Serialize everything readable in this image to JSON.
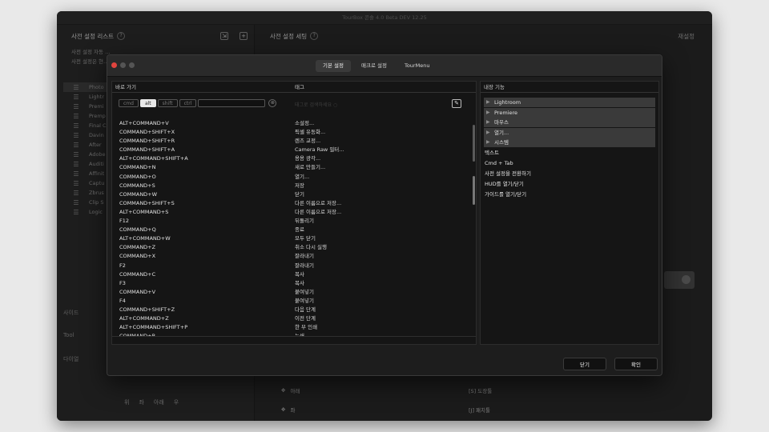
{
  "app": {
    "window_title": "TourBox 콘솔 4.0 Beta DEV 12.25",
    "left_header": "사전 설정 리스트",
    "left_sub": [
      "사전 설정 자동 …",
      "사전 설정은 현…"
    ],
    "presets": [
      "Photo",
      "Lightr",
      "Premi",
      "Premp",
      "Final C",
      "Davin",
      "After",
      "Adobe",
      "Auditi",
      "Affinit",
      "Captu",
      "Zbrus",
      "Clip S",
      "Logic"
    ],
    "left_bottom": [
      "사이드",
      "Tool",
      "다이얼"
    ],
    "directions": [
      "위",
      "좌",
      "아래",
      "우"
    ],
    "right_header": "사전 설정 세팅",
    "reset_label": "재설정",
    "bottom_actions": [
      "아래",
      "좌"
    ],
    "bottom_keys": [
      "[S] 도장툴",
      "[J] 패치툴"
    ]
  },
  "dialog": {
    "tabs": [
      {
        "label": "기본 설정",
        "active": true
      },
      {
        "label": "매크로 설정",
        "active": false
      },
      {
        "label": "TourMenu",
        "active": false
      }
    ],
    "shortcut_header": "바로 가기",
    "tag_header": "태그",
    "builtin_header": "내장 기능",
    "modifier_chips": [
      {
        "label": "cmd",
        "on": false
      },
      {
        "label": "alt",
        "on": true
      },
      {
        "label": "shift",
        "on": false
      },
      {
        "label": "ctrl",
        "on": false
      }
    ],
    "tag_search_placeholder": "태그로 검색하세요 ○",
    "shortcuts": [
      {
        "keys": "ALT+COMMAND+V",
        "tag": "소설정..."
      },
      {
        "keys": "COMMAND+SHIFT+X",
        "tag": "픽셀 유동화..."
      },
      {
        "keys": "COMMAND+SHIFT+R",
        "tag": "렌즈 교정..."
      },
      {
        "keys": "COMMAND+SHIFT+A",
        "tag": "Camera Raw 필터..."
      },
      {
        "keys": "ALT+COMMAND+SHIFT+A",
        "tag": "용용 광각..."
      },
      {
        "keys": "COMMAND+N",
        "tag": "새로 만들기..."
      },
      {
        "keys": "COMMAND+O",
        "tag": "열기..."
      },
      {
        "keys": "COMMAND+S",
        "tag": "저장"
      },
      {
        "keys": "COMMAND+W",
        "tag": "닫기"
      },
      {
        "keys": "COMMAND+SHIFT+S",
        "tag": "다른 이름으로 저장..."
      },
      {
        "keys": "ALT+COMMAND+S",
        "tag": "다른 이름으로 저장..."
      },
      {
        "keys": "F12",
        "tag": "뒤돌리기"
      },
      {
        "keys": "COMMAND+Q",
        "tag": "종료"
      },
      {
        "keys": "ALT+COMMAND+W",
        "tag": "모두 닫기"
      },
      {
        "keys": "COMMAND+Z",
        "tag": "취소 다시 실행"
      },
      {
        "keys": "COMMAND+X",
        "tag": "잘라내기"
      },
      {
        "keys": "F2",
        "tag": "잘라내기"
      },
      {
        "keys": "COMMAND+C",
        "tag": "복사"
      },
      {
        "keys": "F3",
        "tag": "복사"
      },
      {
        "keys": "COMMAND+V",
        "tag": "붙여넣기"
      },
      {
        "keys": "F4",
        "tag": "붙여넣기"
      },
      {
        "keys": "COMMAND+SHIFT+Z",
        "tag": "다음 단계"
      },
      {
        "keys": "ALT+COMMAND+Z",
        "tag": "이전 단계"
      },
      {
        "keys": "ALT+COMMAND+SHIFT+P",
        "tag": "한 부 인쇄"
      },
      {
        "keys": "COMMAND+P",
        "tag": "누쇄"
      }
    ],
    "builtin_groups": [
      "Lightroom",
      "Premiere",
      "마우스",
      "열기...",
      "시스템"
    ],
    "builtin_items": [
      "텍스트",
      "Cmd + Tab",
      "사전 설정을 전환하기",
      "HUD를 열기/닫기",
      "가이드를 열기/닫기"
    ],
    "close_label": "닫기",
    "confirm_label": "확인"
  }
}
